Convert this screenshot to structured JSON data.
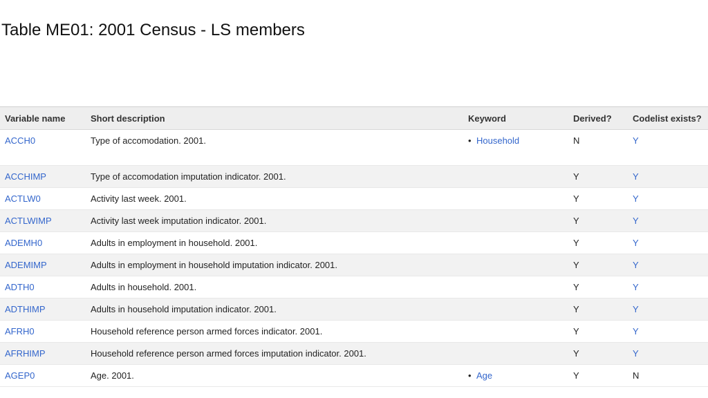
{
  "title": "Table ME01: 2001 Census - LS members",
  "table": {
    "headers": {
      "variable_name": "Variable name",
      "short_description": "Short description",
      "keyword": "Keyword",
      "derived": "Derived?",
      "codelist": "Codelist exists?"
    },
    "rows": [
      {
        "name": "ACCH0",
        "desc": "Type of accomodation. 2001.",
        "keyword": "Household",
        "derived": "N",
        "codelist": "Y"
      },
      {
        "name": "ACCHIMP",
        "desc": "Type of accomodation imputation indicator. 2001.",
        "keyword": "",
        "derived": "Y",
        "codelist": "Y"
      },
      {
        "name": "ACTLW0",
        "desc": "Activity last week. 2001.",
        "keyword": "",
        "derived": "Y",
        "codelist": "Y"
      },
      {
        "name": "ACTLWIMP",
        "desc": "Activity last week imputation indicator. 2001.",
        "keyword": "",
        "derived": "Y",
        "codelist": "Y"
      },
      {
        "name": "ADEMH0",
        "desc": "Adults in employment in household. 2001.",
        "keyword": "",
        "derived": "Y",
        "codelist": "Y"
      },
      {
        "name": "ADEMIMP",
        "desc": "Adults in employment in household imputation indicator. 2001.",
        "keyword": "",
        "derived": "Y",
        "codelist": "Y"
      },
      {
        "name": "ADTH0",
        "desc": "Adults in household. 2001.",
        "keyword": "",
        "derived": "Y",
        "codelist": "Y"
      },
      {
        "name": "ADTHIMP",
        "desc": "Adults in household imputation indicator. 2001.",
        "keyword": "",
        "derived": "Y",
        "codelist": "Y"
      },
      {
        "name": "AFRH0",
        "desc": "Household reference person armed forces indicator. 2001.",
        "keyword": "",
        "derived": "Y",
        "codelist": "Y"
      },
      {
        "name": "AFRHIMP",
        "desc": "Household reference person armed forces imputation indicator. 2001.",
        "keyword": "",
        "derived": "Y",
        "codelist": "Y"
      },
      {
        "name": "AGEP0",
        "desc": "Age. 2001.",
        "keyword": "Age",
        "derived": "Y",
        "codelist": "N"
      }
    ]
  }
}
